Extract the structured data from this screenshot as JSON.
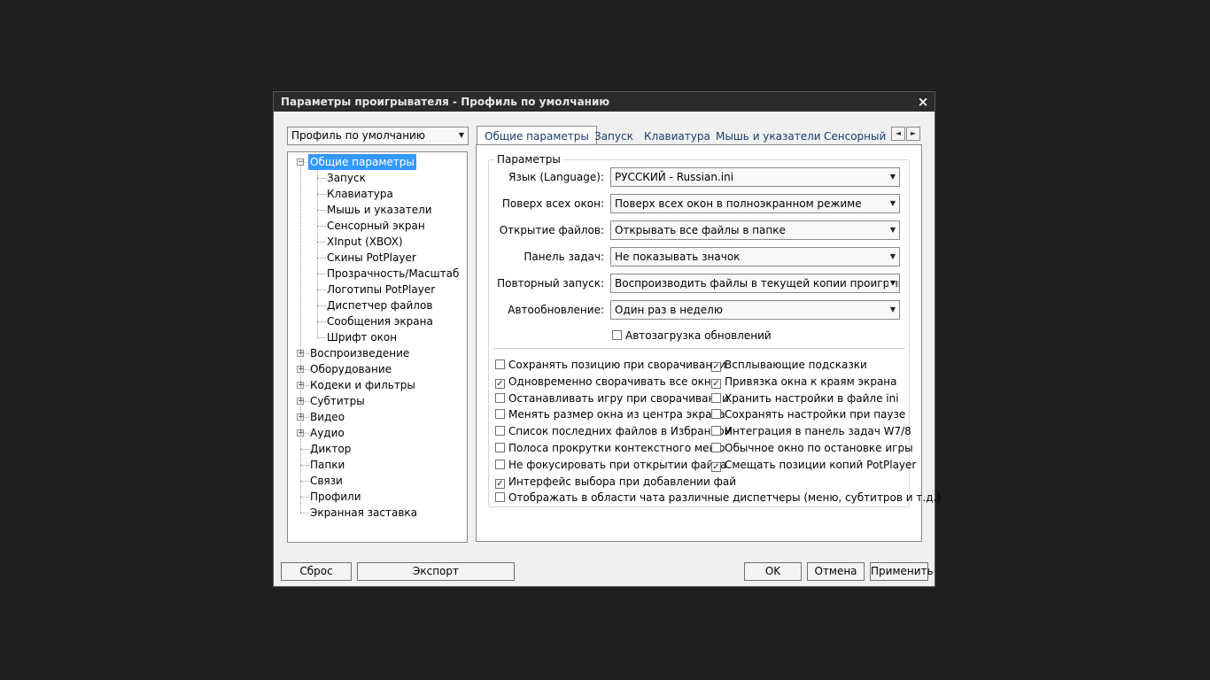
{
  "window": {
    "title": "Параметры проигрывателя - Профиль по умолчанию",
    "close_glyph": "×"
  },
  "profile_combo": {
    "value": "Профиль по умолчанию"
  },
  "tree": {
    "items": [
      {
        "label": "Общие параметры",
        "selected": true
      },
      {
        "label": "Запуск"
      },
      {
        "label": "Клавиатура"
      },
      {
        "label": "Мышь и указатели"
      },
      {
        "label": "Сенсорный экран"
      },
      {
        "label": "XInput (XBOX)"
      },
      {
        "label": "Скины PotPlayer"
      },
      {
        "label": "Прозрачность/Масштаб"
      },
      {
        "label": "Логотипы PotPlayer"
      },
      {
        "label": "Диспетчер файлов"
      },
      {
        "label": "Сообщения экрана"
      },
      {
        "label": "Шрифт окон"
      },
      {
        "label": "Воспроизведение"
      },
      {
        "label": "Оборудование"
      },
      {
        "label": "Кодеки и фильтры"
      },
      {
        "label": "Субтитры"
      },
      {
        "label": "Видео"
      },
      {
        "label": "Аудио"
      },
      {
        "label": "Диктор"
      },
      {
        "label": "Папки"
      },
      {
        "label": "Связи"
      },
      {
        "label": "Профили"
      },
      {
        "label": "Экранная заставка"
      }
    ]
  },
  "tabs": [
    {
      "label": "Общие параметры"
    },
    {
      "label": "Запуск"
    },
    {
      "label": "Клавиатура"
    },
    {
      "label": "Мышь и указатели"
    },
    {
      "label": "Сенсорный эк"
    }
  ],
  "group_title": "Параметры",
  "settings": [
    {
      "label": "Язык (Language):",
      "value": "РУССКИЙ - Russian.ini"
    },
    {
      "label": "Поверх всех окон:",
      "value": "Поверх всех окон в полноэкранном режиме"
    },
    {
      "label": "Открытие файлов:",
      "value": "Открывать все файлы в папке"
    },
    {
      "label": "Панель задач:",
      "value": "Не показывать значок"
    },
    {
      "label": "Повторный запуск:",
      "value": "Воспроизводить файлы в текущей копии проигрывате"
    },
    {
      "label": "Автообновление:",
      "value": "Один раз в неделю"
    }
  ],
  "auto_download": {
    "label": "Автозагрузка обновлений",
    "checked": false
  },
  "checkboxes_left": [
    {
      "label": "Сохранять позицию при сворачивании",
      "checked": false
    },
    {
      "label": "Одновременно сворачивать все окна",
      "checked": true
    },
    {
      "label": "Останавливать игру при сворачивании",
      "checked": false
    },
    {
      "label": "Менять размер окна из центра экрана",
      "checked": false
    },
    {
      "label": "Список последних файлов в Избранном",
      "checked": false
    },
    {
      "label": "Полоса прокрутки контекстного меню",
      "checked": false
    },
    {
      "label": "Не фокусировать при открытии файла",
      "checked": false
    },
    {
      "label": "Интерфейс выбора при добавлении фай",
      "checked": true
    },
    {
      "label": "Отображать в области чата различные диспетчеры (меню, субтитров и т.д.)",
      "checked": false
    }
  ],
  "checkboxes_right": [
    {
      "label": "Всплывающие подсказки",
      "checked": true
    },
    {
      "label": "Привязка окна к краям экрана",
      "checked": true
    },
    {
      "label": "Хранить настройки в файле ini",
      "checked": false
    },
    {
      "label": "Сохранять настройки при паузе",
      "checked": false
    },
    {
      "label": "Интеграция в панель задач W7/8",
      "checked": false
    },
    {
      "label": "Обычное окно по остановке игры",
      "checked": false
    },
    {
      "label": "Смещать позиции копий PotPlayer",
      "checked": true
    }
  ],
  "buttons": {
    "reset": "Сброс",
    "export": "Экспорт",
    "ok": "OK",
    "cancel": "Отмена",
    "apply": "Применить"
  },
  "glyphs": {
    "dropdown": "▼",
    "scroll_left": "◄",
    "scroll_right": "►",
    "check": "✓",
    "minus": "−",
    "plus": "+"
  }
}
